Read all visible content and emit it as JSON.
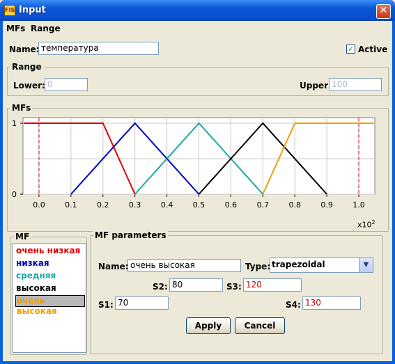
{
  "window": {
    "title": "Input",
    "icon_label": "FIS"
  },
  "menu": [
    "MFs",
    "Range"
  ],
  "name_label": "Name:",
  "name_value": "температура",
  "active": {
    "label": "Active",
    "checked": true
  },
  "range": {
    "title": "Range",
    "lower_label": "Lower:",
    "lower_value": "0",
    "upper_label": "Upper:",
    "upper_value": "100"
  },
  "mfs_group_title": "MFs",
  "chart_data": {
    "type": "line",
    "x_ticks": [
      "0.0",
      "0.1",
      "0.2",
      "0.3",
      "0.4",
      "0.5",
      "0.6",
      "0.7",
      "0.8",
      "0.9",
      "1.0"
    ],
    "y_ticks": [
      "0",
      "1"
    ],
    "x_multiplier_text": "x10",
    "x_multiplier_exp": "2",
    "xlim": [
      -0.05,
      1.05
    ],
    "ylim": [
      0,
      1
    ],
    "grid": true,
    "range_markers": [
      0.0,
      1.0
    ],
    "series": [
      {
        "name": "очень низкая",
        "color": "#e00000",
        "x": [
          -0.05,
          0.2,
          0.3
        ],
        "y": [
          1,
          1,
          0
        ]
      },
      {
        "name": "низкая",
        "color": "#0000c0",
        "x": [
          0.1,
          0.3,
          0.5
        ],
        "y": [
          0,
          1,
          0
        ]
      },
      {
        "name": "средняя",
        "color": "#1aa8a8",
        "x": [
          0.3,
          0.5,
          0.7
        ],
        "y": [
          0,
          1,
          0
        ]
      },
      {
        "name": "высокая",
        "color": "#000000",
        "x": [
          0.5,
          0.7,
          0.9
        ],
        "y": [
          0,
          1,
          0
        ]
      },
      {
        "name": "очень высокая",
        "color": "#f0a000",
        "x": [
          0.7,
          0.8,
          1.3
        ],
        "y": [
          0,
          1,
          1
        ]
      }
    ]
  },
  "mf_list": {
    "title": "MF",
    "items": [
      {
        "label": "очень низкая",
        "color": "#e00000"
      },
      {
        "label": "низкая",
        "color": "#0000c0"
      },
      {
        "label": "средняя",
        "color": "#1aa8a8"
      },
      {
        "label": "высокая",
        "color": "#000000"
      },
      {
        "label": "очень высокая",
        "color": "#f0a000"
      }
    ],
    "selected_index": 4
  },
  "mf_params": {
    "title": "MF parameters",
    "name_label": "Name:",
    "name_value": "очень высокая",
    "type_label": "Type:",
    "type_value": "trapezoidal",
    "s1_label": "S1:",
    "s1_value": "70",
    "s2_label": "S2:",
    "s2_value": "80",
    "s3_label": "S3:",
    "s3_value": "120",
    "s4_label": "S4:",
    "s4_value": "130"
  },
  "buttons": {
    "apply": "Apply",
    "cancel": "Cancel"
  }
}
